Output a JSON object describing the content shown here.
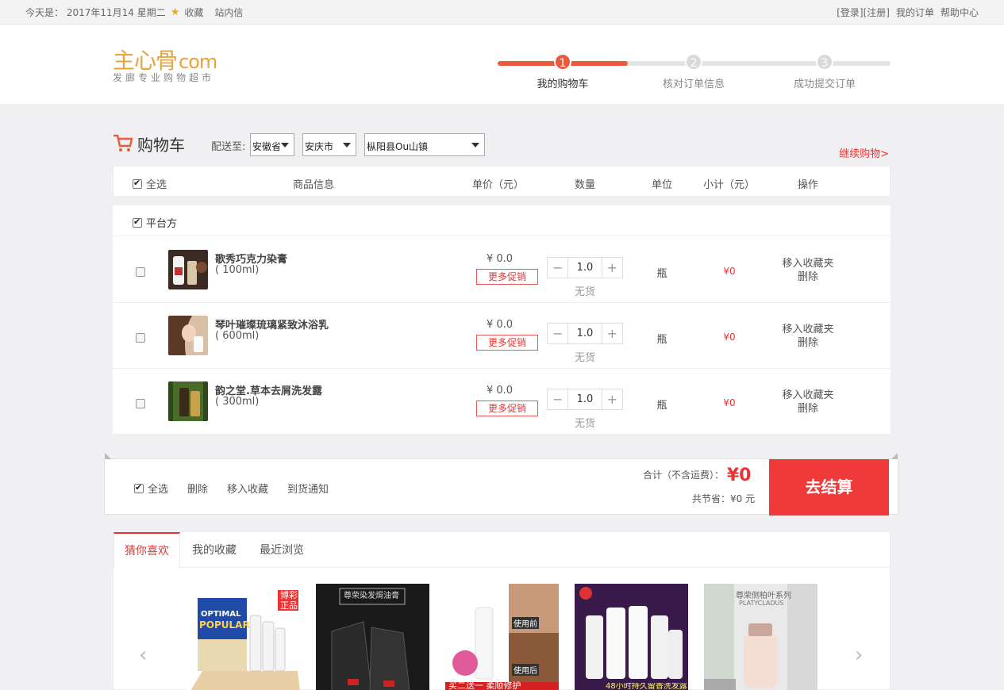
{
  "topbar": {
    "date_text": "今天是： 2017年11月14 星期二",
    "favorite_label": "收藏",
    "messages_label": "站内信",
    "login_label": "[登录]",
    "register_label": "[注册]",
    "orders_label": "我的订单",
    "help_label": "帮助中心"
  },
  "logo": {
    "main": "主心骨",
    "com": "com",
    "sub": "发廊专业购物超市"
  },
  "steps": [
    {
      "num": "1",
      "label": "我的购物车"
    },
    {
      "num": "2",
      "label": "核对订单信息"
    },
    {
      "num": "3",
      "label": "成功提交订单"
    }
  ],
  "cart": {
    "title": "购物车",
    "ship_to_label": "配送至:",
    "province": "安徽省",
    "city": "安庆市",
    "district": "枞阳县Ou山镇",
    "continue_label": "继续购物>"
  },
  "table_head": {
    "select_all": "全选",
    "product": "商品信息",
    "price": "单价（元）",
    "qty": "数量",
    "unit": "单位",
    "subtotal": "小计（元）",
    "ops": "操作"
  },
  "group_label": "平台方",
  "items": [
    {
      "name": "歌秀巧克力染膏",
      "spec": "( 100ml)",
      "price": "¥ 0.0",
      "promo": "更多促销",
      "qty": "1.0",
      "stock": "无货",
      "unit": "瓶",
      "subtotal": "¥0",
      "op_fav": "移入收藏夹",
      "op_del": "删除"
    },
    {
      "name": "琴叶璀璨琉璃紧致沐浴乳",
      "spec": "( 600ml)",
      "price": "¥ 0.0",
      "promo": "更多促销",
      "qty": "1.0",
      "stock": "无货",
      "unit": "瓶",
      "subtotal": "¥0",
      "op_fav": "移入收藏夹",
      "op_del": "删除"
    },
    {
      "name": "韵之堂.草本去屑洗发露",
      "spec": "( 300ml)",
      "price": "¥ 0.0",
      "promo": "更多促销",
      "qty": "1.0",
      "stock": "无货",
      "unit": "瓶",
      "subtotal": "¥0",
      "op_fav": "移入收藏夹",
      "op_del": "删除"
    }
  ],
  "footer": {
    "select_all": "全选",
    "delete": "删除",
    "move_fav": "移入收藏",
    "notify": "到货通知",
    "total_label": "合计（不含运费）：",
    "total_value": "¥0",
    "saved_text": "共节省：¥0 元",
    "checkout": "去结算"
  },
  "rec": {
    "tabs": [
      "猜你喜欢",
      "我的收藏",
      "最近浏览"
    ],
    "items": [
      {
        "badge": "博彩正品",
        "line1": "OPTIMAL",
        "line2": "POPULAR"
      },
      {
        "headline": "尊荣染发焗油膏"
      },
      {
        "caption": "买二送一 柔顺修护",
        "tag": "使用前",
        "tag2": "使用后"
      },
      {
        "caption": "48小时持久留香洗发露"
      },
      {
        "headline": "尊荣侧柏叶系列",
        "sub": "PLATYCLADUS"
      }
    ]
  },
  "colors": {
    "accent": "#ea5a3f",
    "red": "#f03a3a"
  }
}
